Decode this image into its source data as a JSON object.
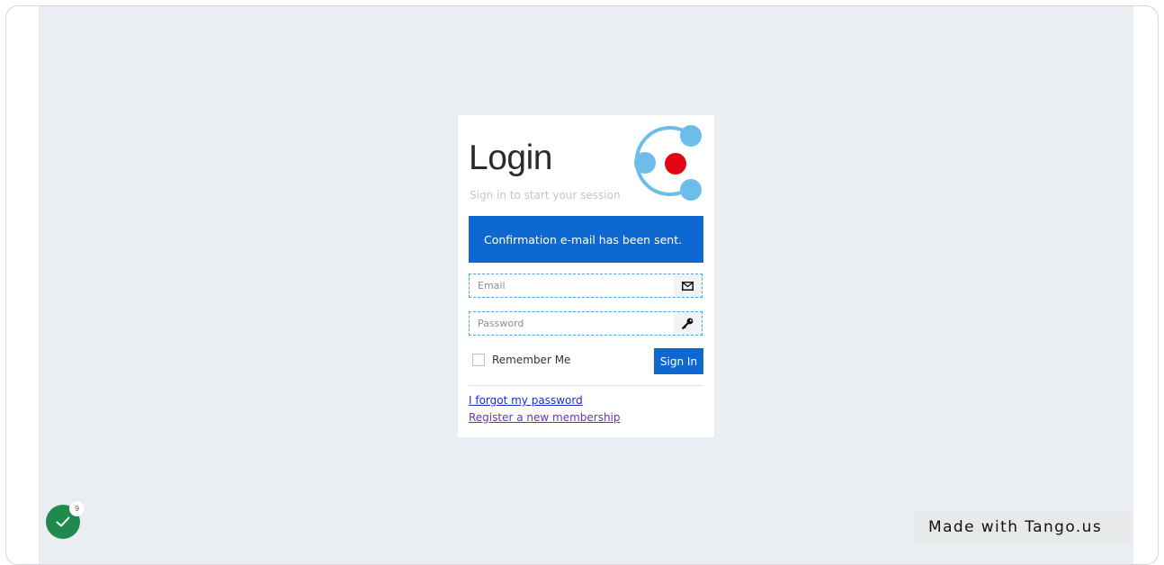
{
  "login": {
    "title": "Login",
    "subtitle": "Sign in to start your session",
    "alert": "Confirmation e-mail has been sent.",
    "email_placeholder": "Email",
    "email_value": "",
    "password_placeholder": "Password",
    "password_value": "",
    "remember_label": "Remember Me",
    "remember_checked": false,
    "signin_label": "Sign In",
    "forgot_link": "I forgot my password",
    "register_link": "Register a new membership"
  },
  "badge": {
    "count": "9"
  },
  "watermark": {
    "text": "Made with Tango.us"
  },
  "icons": {
    "email": "envelope-icon",
    "password": "key-icon",
    "badge": "checkmark-icon"
  },
  "colors": {
    "primary": "#0d68d1",
    "background": "#eaedf2",
    "logo_light_blue": "#6cbde9",
    "logo_red": "#e30613",
    "badge_green": "#1e8a4c"
  }
}
